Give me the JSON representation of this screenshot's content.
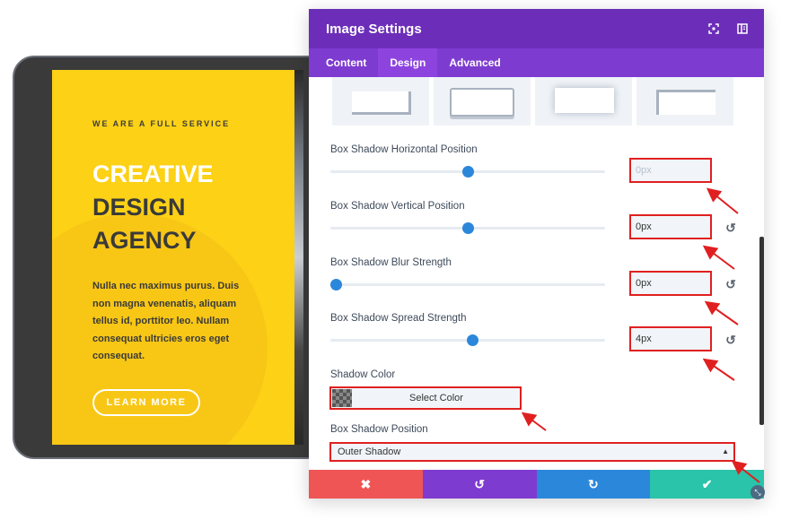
{
  "preview": {
    "eyebrow": "WE ARE A FULL SERVICE",
    "headline_line1": "CREATIVE",
    "headline_line2": "DESIGN",
    "headline_line3": "AGENCY",
    "body": "Nulla nec maximus purus. Duis non magna venenatis, aliquam tellus id, porttitor leo. Nullam consequat ultricies eros eget consequat.",
    "button_label": "LEARN MORE"
  },
  "modal": {
    "title": "Image Settings",
    "header_icons": [
      "fullscreen-icon",
      "sidebar-icon"
    ],
    "tabs": [
      {
        "label": "Content",
        "active": false
      },
      {
        "label": "Design",
        "active": true
      },
      {
        "label": "Advanced",
        "active": false
      }
    ],
    "fields": {
      "horizontal": {
        "label": "Box Shadow Horizontal Position",
        "value": "",
        "placeholder": "0px",
        "slider_fraction": 0.5
      },
      "vertical": {
        "label": "Box Shadow Vertical Position",
        "value": "0px",
        "slider_fraction": 0.5
      },
      "blur": {
        "label": "Box Shadow Blur Strength",
        "value": "0px",
        "slider_fraction": 0.0
      },
      "spread": {
        "label": "Box Shadow Spread Strength",
        "value": "4px",
        "slider_fraction": 0.52
      }
    },
    "shadow_color": {
      "label": "Shadow Color",
      "button": "Select Color"
    },
    "shadow_position": {
      "label": "Box Shadow Position",
      "selected": "Outer Shadow"
    },
    "footer": {
      "cancel_icon": "close-icon",
      "undo_icon": "undo-icon",
      "redo_icon": "redo-icon",
      "save_icon": "check-icon"
    }
  },
  "colors": {
    "header": "#6c2eb9",
    "tabs": "#7e3bd0",
    "accent_blue": "#2b87da",
    "cancel": "#ef5555",
    "save": "#29c4a9",
    "highlight": "#e02020",
    "preview_yellow": "#fcd116"
  }
}
